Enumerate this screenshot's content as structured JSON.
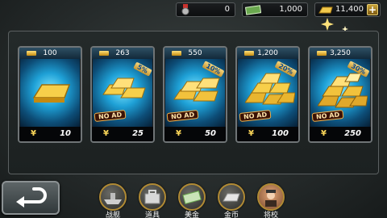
{
  "resources": {
    "medal": {
      "value": "0",
      "icon": "medal-icon"
    },
    "cash": {
      "value": "1,000",
      "icon": "cash-icon"
    },
    "gold": {
      "value": "11,400",
      "icon": "gold-bar-icon"
    },
    "plus_label": "+"
  },
  "packs": [
    {
      "amount": "100",
      "price": "10",
      "currency": "¥",
      "no_ad": "",
      "bonus": ""
    },
    {
      "amount": "263",
      "price": "25",
      "currency": "¥",
      "no_ad": "NO AD",
      "bonus": "5%"
    },
    {
      "amount": "550",
      "price": "50",
      "currency": "¥",
      "no_ad": "NO AD",
      "bonus": "10%"
    },
    {
      "amount": "1,200",
      "price": "100",
      "currency": "¥",
      "no_ad": "NO AD",
      "bonus": "20%"
    },
    {
      "amount": "3,250",
      "price": "250",
      "currency": "¥",
      "no_ad": "NO AD",
      "bonus": "30%"
    }
  ],
  "nav": [
    {
      "label": "战舰",
      "icon": "warship-icon"
    },
    {
      "label": "道具",
      "icon": "toolbox-icon"
    },
    {
      "label": "美金",
      "icon": "cash-icon"
    },
    {
      "label": "金币",
      "icon": "gold-bar-icon"
    },
    {
      "label": "将校",
      "icon": "officer-icon"
    }
  ],
  "colors": {
    "accent_gold": "#ffd85a",
    "card_glow": "#1ea0d6"
  }
}
